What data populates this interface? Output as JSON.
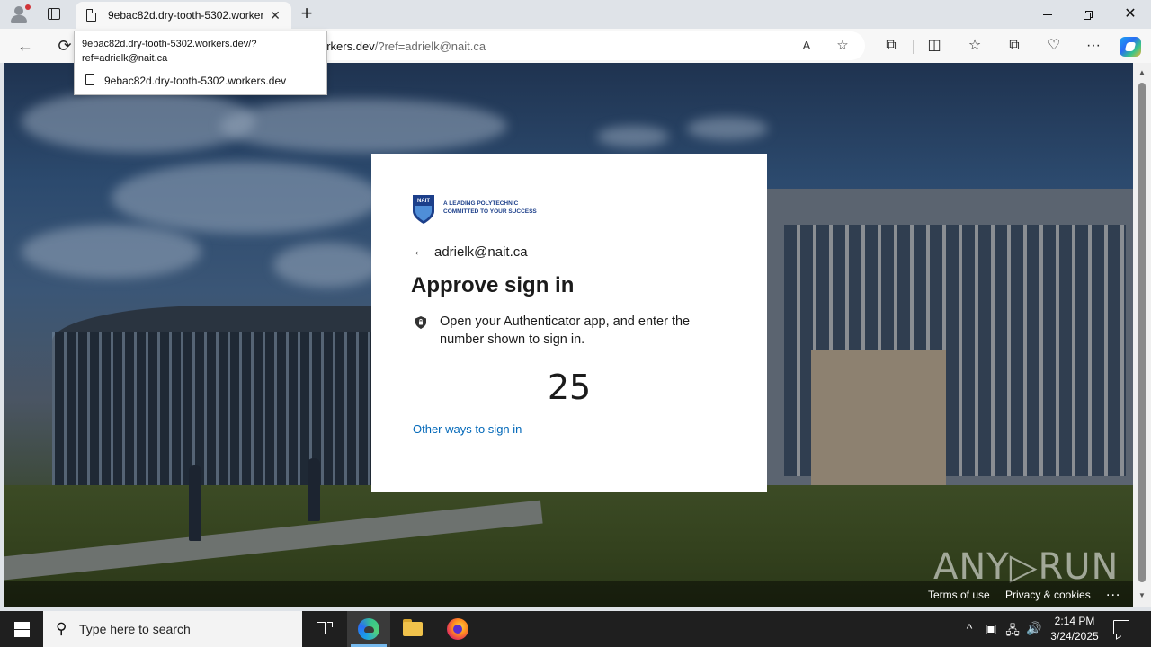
{
  "browser": {
    "tab": {
      "title": "9ebac82d.dry-tooth-5302.workers.dev",
      "close_glyph": "✕"
    },
    "new_tab_glyph": "+",
    "window_controls": {
      "close_glyph": "✕"
    },
    "address": {
      "url_host_suffix": "orkers.dev",
      "url_path": "/?ref=adrielk@nait.ca",
      "read_aloud_glyph": "A"
    },
    "dropdown": {
      "full_url": "9ebac82d.dry-tooth-5302.workers.dev/?ref=adrielk@nait.ca",
      "suggestion": "9ebac82d.dry-tooth-5302.workers.dev"
    },
    "icons": {
      "back": "←",
      "reload": "⟳",
      "star": "☆",
      "extensions": "⧉",
      "split_screen": "◫",
      "favorites": "☆",
      "collections": "⧉",
      "performance": "♡",
      "menu": "···"
    }
  },
  "page": {
    "logo_tagline_1": "A LEADING POLYTECHNIC",
    "logo_tagline_2": "COMMITTED TO YOUR SUCCESS",
    "logo_text": "NAIT",
    "back_arrow": "←",
    "email": "adrielk@nait.ca",
    "heading": "Approve sign in",
    "instructions": "Open your Authenticator app, and enter the number shown to sign in.",
    "code": "25",
    "other_ways": "Other ways to sign in",
    "footer": {
      "terms": "Terms of use",
      "privacy": "Privacy & cookies",
      "more": "..."
    },
    "watermark": "ANY▷RUN"
  },
  "scrollbar": {
    "up": "▲",
    "down": "▼"
  },
  "taskbar": {
    "search_placeholder": "Type here to search",
    "search_icon": "⚲",
    "tray": {
      "chevron": "^",
      "meet": "▣",
      "network": "🖧",
      "volume": "🔊"
    },
    "time": "2:14 PM",
    "date": "3/24/2025"
  },
  "colors": {
    "link": "#0067b8",
    "nait_blue": "#1c3f8a"
  }
}
